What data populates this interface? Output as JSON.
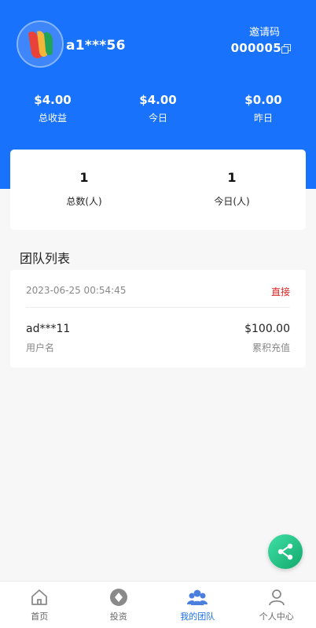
{
  "profile": {
    "username": "a1***56",
    "invite_label": "邀请码",
    "invite_code": "000005"
  },
  "stats": [
    {
      "value": "$4.00",
      "label": "总收益"
    },
    {
      "value": "$4.00",
      "label": "今日"
    },
    {
      "value": "$0.00",
      "label": "昨日"
    }
  ],
  "team": [
    {
      "value": "1",
      "label": "总数(人)"
    },
    {
      "value": "1",
      "label": "今日(人)"
    }
  ],
  "team_list": {
    "title": "团队列表",
    "items": [
      {
        "date": "2023-06-25 00:54:45",
        "type": "直接",
        "username": "ad***11",
        "username_label": "用户名",
        "amount": "$100.00",
        "amount_label": "累积充值"
      }
    ]
  },
  "tabbar": [
    {
      "label": "首页",
      "icon": "home-icon",
      "active": false
    },
    {
      "label": "投资",
      "icon": "invest-icon",
      "active": false
    },
    {
      "label": "我的团队",
      "icon": "team-icon",
      "active": true
    },
    {
      "label": "个人中心",
      "icon": "user-icon",
      "active": false
    }
  ],
  "colors": {
    "header_bg": "#1872fb",
    "accent": "#1a6fe8",
    "direct_tag": "#dd2222",
    "share_button": "#1fbf82"
  }
}
